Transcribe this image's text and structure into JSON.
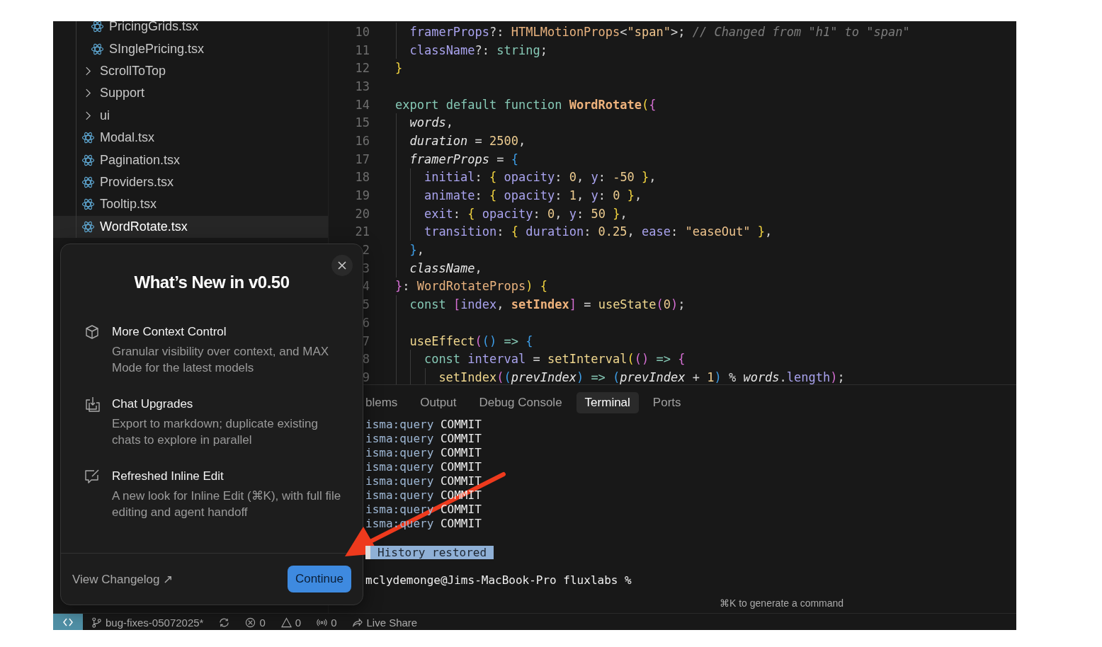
{
  "explorer": {
    "scrolled_children": [
      {
        "name": "PricingGrids.tsx",
        "kind": "file",
        "selected": false
      },
      {
        "name": "SInglePricing.tsx",
        "kind": "file",
        "selected": false
      }
    ],
    "items": [
      {
        "name": "ScrollToTop",
        "kind": "folder",
        "selected": false
      },
      {
        "name": "Support",
        "kind": "folder",
        "selected": false
      },
      {
        "name": "ui",
        "kind": "folder",
        "selected": false
      },
      {
        "name": "Modal.tsx",
        "kind": "file",
        "selected": false
      },
      {
        "name": "Pagination.tsx",
        "kind": "file",
        "selected": false
      },
      {
        "name": "Providers.tsx",
        "kind": "file",
        "selected": false
      },
      {
        "name": "Tooltip.tsx",
        "kind": "file",
        "selected": false
      },
      {
        "name": "WordRotate.tsx",
        "kind": "file",
        "selected": true
      }
    ]
  },
  "editor": {
    "scrolled_children": [
      {
        "number": "10",
        "tokens": [
          {
            "text": "framerProps",
            "kind": "prop"
          },
          {
            "text": "?:",
            "kind": "plain"
          },
          {
            "text": " HTMLMotionProps",
            "kind": "type"
          },
          {
            "text": "<",
            "kind": "plain"
          },
          {
            "text": "\"span\"",
            "kind": "string"
          },
          {
            "text": ">;",
            "kind": "plain"
          },
          {
            "text": " // Changed from \"h1\" to \"span\"",
            "kind": "comment"
          }
        ]
      },
      {
        "number": "11",
        "tokens": [
          {
            "text": "className",
            "kind": "prop"
          },
          {
            "text": "?:",
            "kind": "plain"
          },
          {
            "text": " string",
            "kind": "keyword"
          },
          {
            "text": ";",
            "kind": "plain"
          }
        ]
      }
    ],
    "lines": [
      {
        "number": "12",
        "tokens": [
          {
            "text": "}",
            "kind": "b-yellow"
          }
        ]
      },
      {
        "number": "13"
      },
      {
        "number": "14",
        "tokens": [
          {
            "text": "export default function",
            "kind": "keyword"
          },
          {
            "text": " WordRotate",
            "kind": "fn-bold"
          },
          {
            "text": "(",
            "kind": "b-yellow"
          },
          {
            "text": "{",
            "kind": "b-pink"
          }
        ],
        "children": [
          {
            "number": "15",
            "tokens": [
              {
                "text": "words",
                "kind": "param"
              },
              {
                "text": ",",
                "kind": "plain"
              }
            ]
          },
          {
            "number": "16",
            "tokens": [
              {
                "text": "duration",
                "kind": "param"
              },
              {
                "text": " =",
                "kind": "plain"
              },
              {
                "text": " 2500",
                "kind": "number"
              },
              {
                "text": ",",
                "kind": "plain"
              }
            ]
          },
          {
            "number": "17",
            "tokens": [
              {
                "text": "framerProps",
                "kind": "param"
              },
              {
                "text": " =",
                "kind": "plain"
              },
              {
                "text": " {",
                "kind": "b-blue"
              }
            ],
            "children": [
              {
                "number": "18",
                "tokens": [
                  {
                    "text": "initial",
                    "kind": "prop"
                  },
                  {
                    "text": ":",
                    "kind": "plain"
                  },
                  {
                    "text": " {",
                    "kind": "b-yellow"
                  },
                  {
                    "text": " opacity",
                    "kind": "prop"
                  },
                  {
                    "text": ":",
                    "kind": "plain"
                  },
                  {
                    "text": " 0",
                    "kind": "number"
                  },
                  {
                    "text": ",",
                    "kind": "plain"
                  },
                  {
                    "text": " y",
                    "kind": "prop"
                  },
                  {
                    "text": ":",
                    "kind": "plain"
                  },
                  {
                    "text": " -50",
                    "kind": "number"
                  },
                  {
                    "text": " }",
                    "kind": "b-yellow"
                  },
                  {
                    "text": ",",
                    "kind": "plain"
                  }
                ]
              },
              {
                "number": "19",
                "tokens": [
                  {
                    "text": "animate",
                    "kind": "prop"
                  },
                  {
                    "text": ":",
                    "kind": "plain"
                  },
                  {
                    "text": " {",
                    "kind": "b-yellow"
                  },
                  {
                    "text": " opacity",
                    "kind": "prop"
                  },
                  {
                    "text": ":",
                    "kind": "plain"
                  },
                  {
                    "text": " 1",
                    "kind": "number"
                  },
                  {
                    "text": ",",
                    "kind": "plain"
                  },
                  {
                    "text": " y",
                    "kind": "prop"
                  },
                  {
                    "text": ":",
                    "kind": "plain"
                  },
                  {
                    "text": " 0",
                    "kind": "number"
                  },
                  {
                    "text": " }",
                    "kind": "b-yellow"
                  },
                  {
                    "text": ",",
                    "kind": "plain"
                  }
                ]
              },
              {
                "number": "20",
                "tokens": [
                  {
                    "text": "exit",
                    "kind": "prop"
                  },
                  {
                    "text": ":",
                    "kind": "plain"
                  },
                  {
                    "text": " {",
                    "kind": "b-yellow"
                  },
                  {
                    "text": " opacity",
                    "kind": "prop"
                  },
                  {
                    "text": ":",
                    "kind": "plain"
                  },
                  {
                    "text": " 0",
                    "kind": "number"
                  },
                  {
                    "text": ",",
                    "kind": "plain"
                  },
                  {
                    "text": " y",
                    "kind": "prop"
                  },
                  {
                    "text": ":",
                    "kind": "plain"
                  },
                  {
                    "text": " 50",
                    "kind": "number"
                  },
                  {
                    "text": " }",
                    "kind": "b-yellow"
                  },
                  {
                    "text": ",",
                    "kind": "plain"
                  }
                ]
              },
              {
                "number": "21",
                "tokens": [
                  {
                    "text": "transition",
                    "kind": "prop"
                  },
                  {
                    "text": ":",
                    "kind": "plain"
                  },
                  {
                    "text": " {",
                    "kind": "b-yellow"
                  },
                  {
                    "text": " duration",
                    "kind": "prop"
                  },
                  {
                    "text": ":",
                    "kind": "plain"
                  },
                  {
                    "text": " 0.25",
                    "kind": "number"
                  },
                  {
                    "text": ",",
                    "kind": "plain"
                  },
                  {
                    "text": " ease",
                    "kind": "prop"
                  },
                  {
                    "text": ":",
                    "kind": "plain"
                  },
                  {
                    "text": " \"easeOut\"",
                    "kind": "string"
                  },
                  {
                    "text": " }",
                    "kind": "b-yellow"
                  },
                  {
                    "text": ",",
                    "kind": "plain"
                  }
                ]
              }
            ]
          },
          {
            "number": "2",
            "tokens": [
              {
                "text": "}",
                "kind": "b-blue"
              },
              {
                "text": ",",
                "kind": "plain"
              }
            ]
          },
          {
            "number": "3",
            "tokens": [
              {
                "text": "className",
                "kind": "param"
              },
              {
                "text": ",",
                "kind": "plain"
              }
            ]
          }
        ]
      },
      {
        "number": "4",
        "tokens": [
          {
            "text": "}",
            "kind": "b-pink"
          },
          {
            "text": ":",
            "kind": "plain"
          },
          {
            "text": " WordRotateProps",
            "kind": "type"
          },
          {
            "text": ")",
            "kind": "b-yellow"
          },
          {
            "text": " {",
            "kind": "b-yellow"
          }
        ],
        "children": [
          {
            "number": "5",
            "tokens": [
              {
                "text": "const",
                "kind": "keyword"
              },
              {
                "text": " [",
                "kind": "b-pink"
              },
              {
                "text": "index",
                "kind": "var"
              },
              {
                "text": ",",
                "kind": "plain"
              },
              {
                "text": " setIndex",
                "kind": "fn-bold"
              },
              {
                "text": "]",
                "kind": "b-pink"
              },
              {
                "text": " =",
                "kind": "plain"
              },
              {
                "text": " useState",
                "kind": "func"
              },
              {
                "text": "(",
                "kind": "b-pink"
              },
              {
                "text": "0",
                "kind": "number"
              },
              {
                "text": ")",
                "kind": "b-pink"
              },
              {
                "text": ";",
                "kind": "plain"
              }
            ]
          },
          {
            "number": "6"
          },
          {
            "number": "7",
            "tokens": [
              {
                "text": "useEffect",
                "kind": "func"
              },
              {
                "text": "(",
                "kind": "b-pink"
              },
              {
                "text": "()",
                "kind": "b-blue"
              },
              {
                "text": " =>",
                "kind": "keyword"
              },
              {
                "text": " {",
                "kind": "b-blue"
              }
            ],
            "children": [
              {
                "number": "8",
                "tokens": [
                  {
                    "text": "const",
                    "kind": "keyword"
                  },
                  {
                    "text": " interval",
                    "kind": "var"
                  },
                  {
                    "text": " =",
                    "kind": "plain"
                  },
                  {
                    "text": " setInterval",
                    "kind": "func"
                  },
                  {
                    "text": "(",
                    "kind": "b-yellow"
                  },
                  {
                    "text": "()",
                    "kind": "b-pink"
                  },
                  {
                    "text": " =>",
                    "kind": "keyword"
                  },
                  {
                    "text": " {",
                    "kind": "b-pink"
                  }
                ],
                "children": [
                  {
                    "number": "9",
                    "tokens": [
                      {
                        "text": "setIndex",
                        "kind": "func"
                      },
                      {
                        "text": "(",
                        "kind": "b-pink"
                      },
                      {
                        "text": "(",
                        "kind": "b-blue"
                      },
                      {
                        "text": "prevIndex",
                        "kind": "param"
                      },
                      {
                        "text": ")",
                        "kind": "b-blue"
                      },
                      {
                        "text": " =>",
                        "kind": "keyword"
                      },
                      {
                        "text": " (",
                        "kind": "b-blue"
                      },
                      {
                        "text": "prevIndex",
                        "kind": "param"
                      },
                      {
                        "text": " +",
                        "kind": "plain"
                      },
                      {
                        "text": " 1",
                        "kind": "number"
                      },
                      {
                        "text": ")",
                        "kind": "b-blue"
                      },
                      {
                        "text": " %",
                        "kind": "plain"
                      },
                      {
                        "text": " words",
                        "kind": "param"
                      },
                      {
                        "text": ".",
                        "kind": "plain"
                      },
                      {
                        "text": "length",
                        "kind": "prop"
                      },
                      {
                        "text": ")",
                        "kind": "b-pink"
                      },
                      {
                        "text": ";",
                        "kind": "plain"
                      }
                    ]
                  }
                ]
              }
            ]
          }
        ]
      }
    ]
  },
  "panel": {
    "tabs": [
      {
        "label": "blems",
        "selected": false
      },
      {
        "label": "Output",
        "selected": false
      },
      {
        "label": "Debug Console",
        "selected": false
      },
      {
        "label": "Terminal",
        "selected": true
      },
      {
        "label": "Ports",
        "selected": false
      }
    ],
    "terminal": {
      "log": [
        {
          "source": "isma:query",
          "text": "COMMIT"
        },
        {
          "source": "isma:query",
          "text": "COMMIT"
        },
        {
          "source": "isma:query",
          "text": "COMMIT"
        },
        {
          "source": "isma:query",
          "text": "COMMIT"
        },
        {
          "source": "isma:query",
          "text": "COMMIT"
        },
        {
          "source": "isma:query",
          "text": "COMMIT"
        },
        {
          "source": "isma:query",
          "text": "COMMIT"
        },
        {
          "source": "isma:query",
          "text": "COMMIT"
        }
      ],
      "notice": "History restored",
      "prompt": "mclydemonge@Jims-MacBook-Pro fluxlabs %",
      "hint": "⌘K to generate a command"
    }
  },
  "dialog": {
    "title": "What’s New in v0.50",
    "features": [
      {
        "kind": "cube",
        "title": "More Context Control",
        "description": "Granular visibility over context, and MAX Mode for the latest models"
      },
      {
        "kind": "export",
        "title": "Chat Upgrades",
        "description": "Export to markdown; duplicate existing chats to explore in parallel"
      },
      {
        "kind": "edit",
        "title": "Refreshed Inline Edit",
        "description": "A new look for Inline Edit (⌘K), with full file editing and agent handoff"
      }
    ],
    "link": "View Changelog ↗",
    "button": "Continue"
  },
  "status_bar": [
    {
      "kind": "remote"
    },
    {
      "kind": "branch",
      "text": "bug-fixes-05072025*"
    },
    {
      "kind": "sync"
    },
    {
      "kind": "errors",
      "text": "0"
    },
    {
      "kind": "warnings",
      "text": "0"
    },
    {
      "kind": "ports",
      "text": "0"
    },
    {
      "kind": "liveshare",
      "text": "Live Share"
    }
  ]
}
